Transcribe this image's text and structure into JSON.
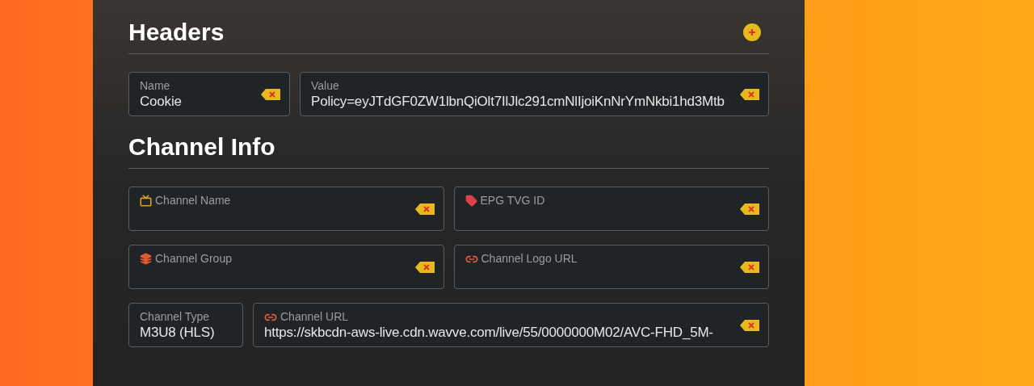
{
  "sections": [
    {
      "title": "Headers",
      "add_button": true,
      "rows": [
        [
          {
            "kind": "key",
            "label": "Name",
            "value": "Cookie",
            "clearable": true
          },
          {
            "kind": "value",
            "label": "Value",
            "value": "Policy=eyJTdGF0ZW1lbnQiOlt7IlJlc291cmNlIjoiKnNrYmNkbi1hd3Mtb",
            "clearable": true
          }
        ]
      ]
    },
    {
      "title": "Channel Info",
      "add_button": false,
      "rows": [
        [
          {
            "kind": "name",
            "label": "Channel Name",
            "clearable": true
          },
          {
            "kind": "id",
            "label": "EPG TVG ID",
            "clearable": true
          }
        ],
        [
          {
            "kind": "group",
            "label": "Channel Group",
            "clearable": true
          },
          {
            "kind": "url",
            "label": "Channel Logo URL",
            "clearable": true
          }
        ],
        [
          {
            "kind": "type",
            "label": "Channel Type",
            "value": "M3U8 (HLS)",
            "clearable": false
          },
          {
            "kind": "url",
            "label": "Channel URL",
            "value": "https://skbcdn-aws-live.cdn.wavve.com/live/55/0000000M02/AVC-FHD_5M-",
            "clearable": true
          }
        ]
      ]
    }
  ]
}
